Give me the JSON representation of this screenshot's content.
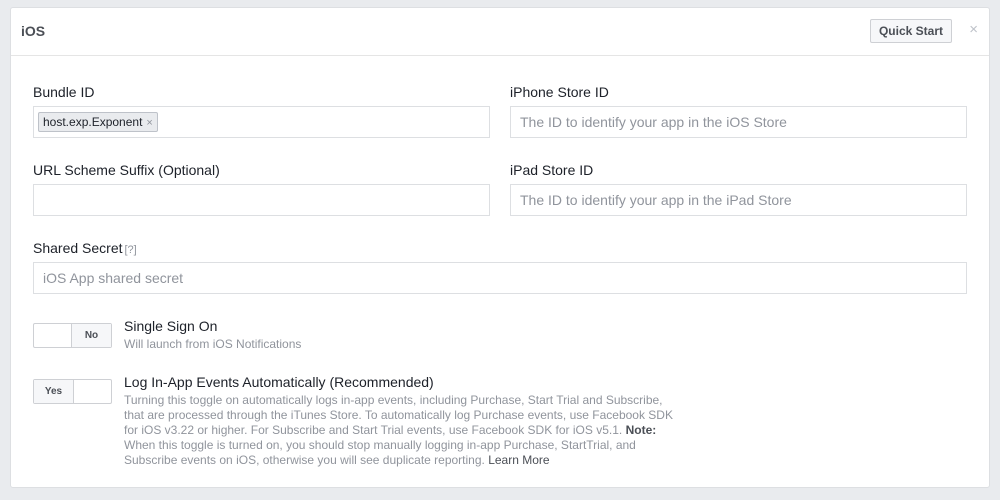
{
  "header": {
    "title": "iOS",
    "quick_start_label": "Quick Start",
    "close_glyph": "×"
  },
  "fields": {
    "bundle_id": {
      "label": "Bundle ID",
      "tokens": [
        "host.exp.Exponent"
      ],
      "token_remove_glyph": "×"
    },
    "iphone_store_id": {
      "label": "iPhone Store ID",
      "value": "",
      "placeholder": "The ID to identify your app in the iOS Store"
    },
    "url_scheme_suffix": {
      "label": "URL Scheme Suffix (Optional)",
      "value": "",
      "placeholder": ""
    },
    "ipad_store_id": {
      "label": "iPad Store ID",
      "value": "",
      "placeholder": "The ID to identify your app in the iPad Store"
    },
    "shared_secret": {
      "label": "Shared Secret",
      "help": "[?]",
      "value": "",
      "placeholder": "iOS App shared secret"
    }
  },
  "options": {
    "single_sign_on": {
      "toggle_label": "No",
      "state": "off",
      "title": "Single Sign On",
      "description": "Will launch from iOS Notifications"
    },
    "log_events": {
      "toggle_label": "Yes",
      "state": "on",
      "title": "Log In-App Events Automatically (Recommended)",
      "description_line1": "Turning this toggle on automatically logs in-app events, including Purchase, Start Trial and Subscribe,",
      "description_line2": "that are processed through the iTunes Store. To automatically log Purchase events, use Facebook SDK",
      "description_line3": "for iOS v3.22 or higher. For Subscribe and Start Trial events, use Facebook SDK for iOS v5.1.",
      "note_label": "Note:",
      "description_line4": "When this toggle is turned on, you should stop manually logging in-app Purchase, StartTrial, and",
      "description_line5": "Subscribe events on iOS, otherwise you will see duplicate reporting.",
      "learn_more": "Learn More"
    }
  }
}
